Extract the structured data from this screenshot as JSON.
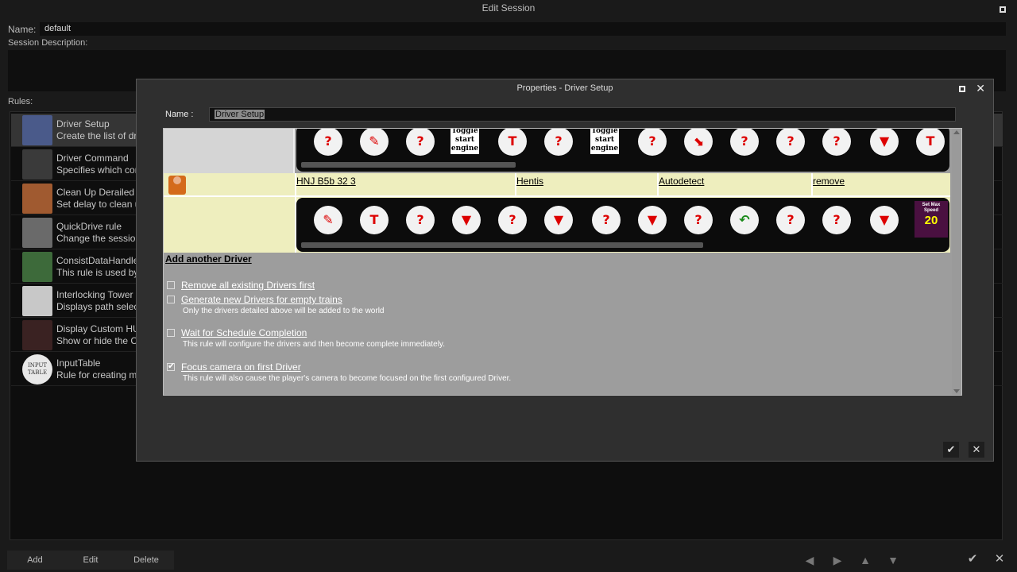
{
  "window": {
    "title": "Edit Session"
  },
  "session": {
    "name_label": "Name:",
    "name_value": "default",
    "description_label": "Session Description:",
    "rules_label": "Rules:"
  },
  "rules": [
    {
      "name": "Driver Setup",
      "desc": "Create the list of dr",
      "icon": "driver-icon"
    },
    {
      "name": "Driver Command",
      "desc": "Specifies which com",
      "icon": "signal-icon"
    },
    {
      "name": "Clean Up Derailed T",
      "desc": "Set delay to clean u",
      "icon": "derail-icon"
    },
    {
      "name": "QuickDrive rule",
      "desc": "Change the session",
      "icon": "quickdrive-icon"
    },
    {
      "name": "ConsistDataHandle",
      "desc": "This rule is used by",
      "icon": "consist-icon"
    },
    {
      "name": "Interlocking Tower R",
      "desc": "Displays path selec",
      "icon": "interlocking-icon"
    },
    {
      "name": "Display Custom HU",
      "desc": "Show or hide the Cu",
      "icon": "hud-icon"
    },
    {
      "name": "InputTable",
      "desc": "Rule for creating m",
      "icon": "input-table-icon",
      "icon_text": "INPUT TABLE"
    }
  ],
  "bottom_buttons": {
    "add": "Add",
    "edit": "Edit",
    "delete": "Delete"
  },
  "dialog": {
    "title": "Properties - Driver Setup",
    "name_label": "Name :",
    "name_value": "Driver Setup",
    "driver": {
      "train": "HNJ B5b 32 3",
      "driver_name": "Hentis",
      "mode": "Autodetect",
      "remove": "remove"
    },
    "commands_row1": [
      "Toggle start engine"
    ],
    "commands_row2_sign": "Set Max Speed",
    "commands_row2_speed": "20",
    "add_driver": "Add another Driver",
    "options": [
      {
        "label": "Remove all existing Drivers first",
        "desc": "",
        "checked": false
      },
      {
        "label": "Generate new Drivers for empty trains",
        "desc": "Only the drivers detailed above will be added to the world",
        "checked": false
      },
      {
        "label": "Wait for Schedule Completion",
        "desc": "This rule will configure the drivers and then become complete immediately.",
        "checked": false
      },
      {
        "label": "Focus camera on first Driver",
        "desc": "This rule will also cause the player's camera to become focused on the first configured Driver.",
        "checked": true
      }
    ]
  }
}
